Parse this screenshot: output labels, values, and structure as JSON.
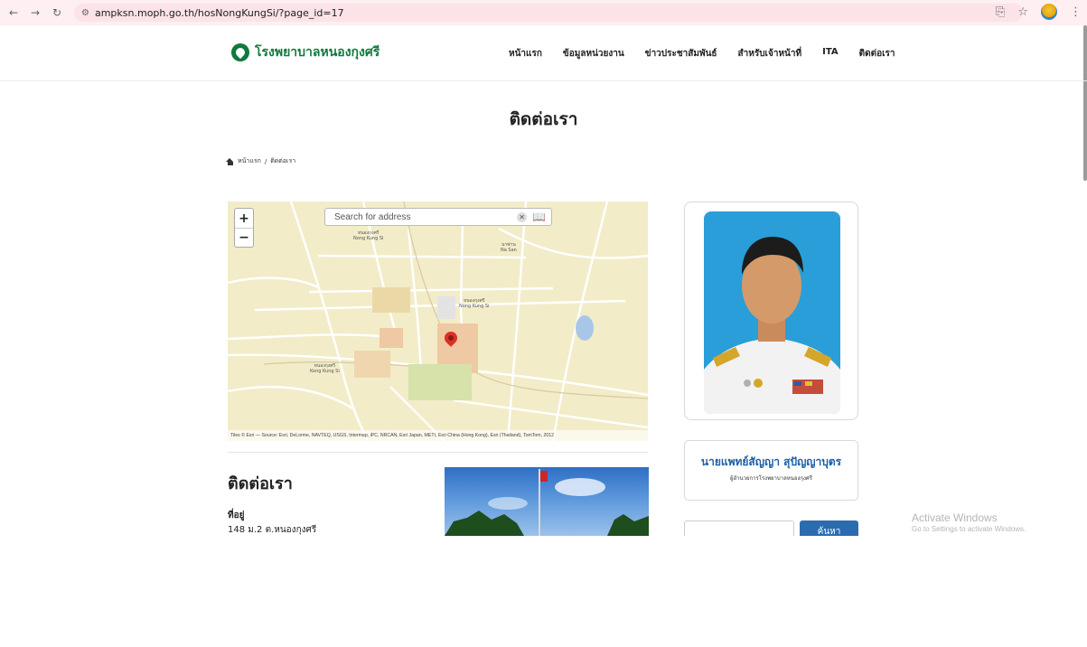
{
  "browser": {
    "url": "ampksn.moph.go.th/hosNongKungSi/?page_id=17"
  },
  "header": {
    "logo_text": "โรงพยาบาลหนองกุงศรี",
    "nav": [
      "หน้าแรก",
      "ข้อมูลหน่วยงาน",
      "ข่าวประชาสัมพันธ์",
      "สำหรับเจ้าหน้าที่",
      "ITA",
      "ติดต่อเรา"
    ]
  },
  "page": {
    "title": "ติดต่อเรา",
    "breadcrumb": {
      "home": "หน้าแรก",
      "separator": "/",
      "current": "ติดต่อเรา"
    }
  },
  "map": {
    "zoom_in": "+",
    "zoom_out": "−",
    "search_placeholder": "Search for address",
    "attribution": "Tiles © Esri — Source: Esri, DeLorme, NAVTEQ, USGS, Intermap, iPC, NRCAN, Esri Japan, METI, Esri China (Hong Kong), Esri (Thailand), TomTom, 2012",
    "labels": {
      "town_north_th": "หนองกุงศรี",
      "town_north_en": "Nong Kung Si",
      "nasan_th": "นาซ่าน",
      "nasan_en": "Na San",
      "town_center_th": "หนองกุงศรี",
      "town_center_en": "Nong Kung Si",
      "town_west_th": "หนองกุงศรี",
      "town_west_en": "Kong Kung Si"
    }
  },
  "contact": {
    "heading": "ติดต่อเรา",
    "address_label": "ที่อยู่",
    "address_line1": "148 ม.2 ต.หนองกุงศรี"
  },
  "sidebar": {
    "director_name": "นายแพทย์สัญญา สุปัญญาบุตร",
    "director_title": "ผู้อำนวยการโรงพยาบาลหนองกุงศรี",
    "search_button": "ค้นหา"
  },
  "watermark": {
    "title": "Activate Windows",
    "subtitle": "Go to Settings to activate Windows."
  },
  "colors": {
    "brand_green": "#0f7a3d",
    "accent_blue": "#2b6cb0",
    "browser_bar": "#fdeff2"
  }
}
